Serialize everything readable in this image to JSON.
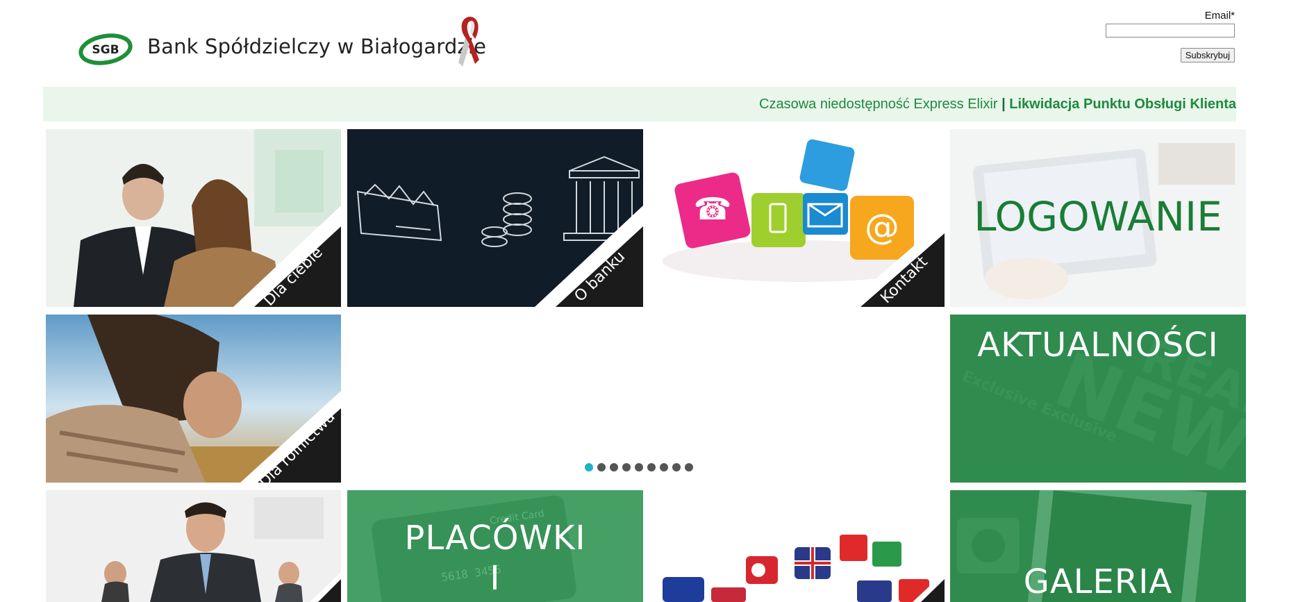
{
  "header": {
    "logo_text": "SGB",
    "bank_name": "Bank Spółdzielczy w Białogardzie"
  },
  "subscribe": {
    "email_label": "Email*",
    "email_value": "",
    "button_label": "Subskrybuj"
  },
  "ticker": {
    "item1": "Czasowa niedostępność Express Elixir",
    "separator": "|",
    "item2": "Likwidacja Punktu Obsługi Klienta"
  },
  "tiles": {
    "dla_ciebie": "Dla ciebie",
    "o_banku": "O banku",
    "kontakt": "Kontakt",
    "logowanie": "LOGOWANIE",
    "dla_rolnictwa": "Dla rolnictwa",
    "aktualnosci": "AKTUALNOŚCI",
    "placowki_line1": "PLACÓWKI",
    "placowki_line2": "I",
    "galeria": "GALERIA"
  },
  "slider": {
    "total": 9,
    "active_index": 0
  },
  "colors": {
    "brand_green": "#1d8a3c",
    "ticker_bg": "#eaf6ec",
    "active_dot": "#1fb4c4"
  }
}
